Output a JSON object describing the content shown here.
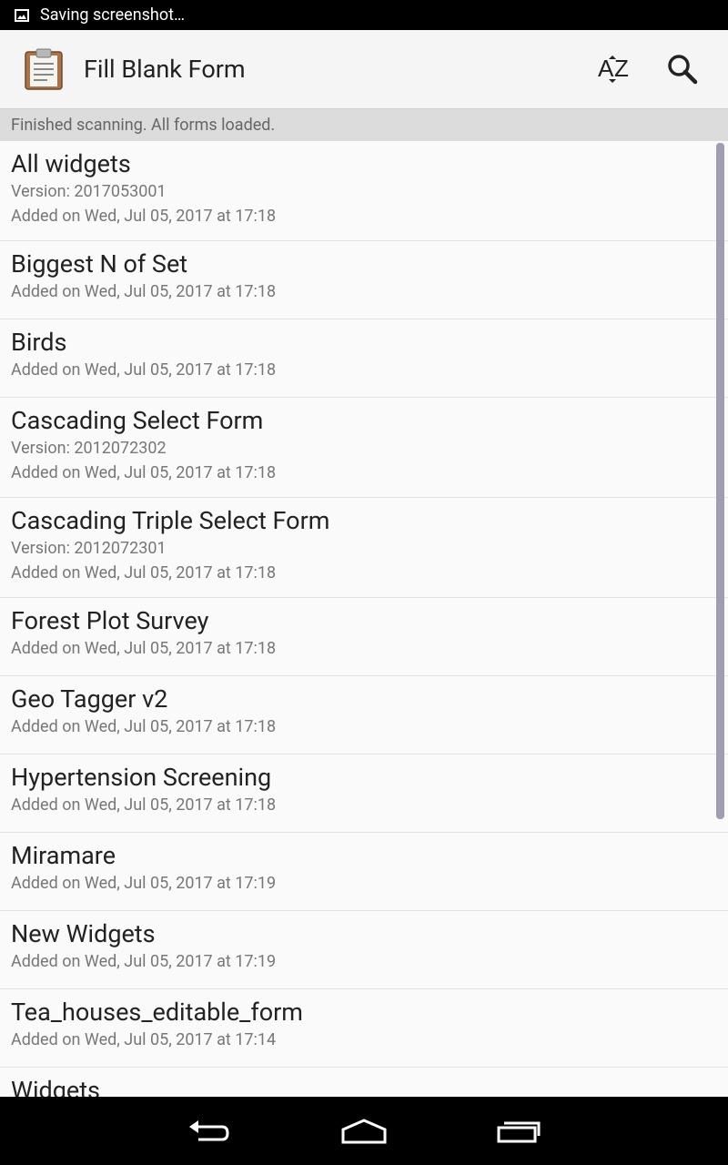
{
  "status_bar": {
    "text": "Saving screenshot…",
    "icon": "image-icon"
  },
  "action_bar": {
    "title": "Fill Blank Form",
    "app_icon": "clipboard-icon",
    "actions": [
      {
        "name": "sort",
        "icon": "sort-az-icon"
      },
      {
        "name": "search",
        "icon": "search-icon"
      }
    ]
  },
  "status_message": "Finished scanning. All forms loaded.",
  "forms": [
    {
      "name": "All widgets",
      "version": "Version: 2017053001",
      "added": "Added on Wed, Jul 05, 2017 at 17:18"
    },
    {
      "name": "Biggest N of Set",
      "added": "Added on Wed, Jul 05, 2017 at 17:18"
    },
    {
      "name": "Birds",
      "added": "Added on Wed, Jul 05, 2017 at 17:18"
    },
    {
      "name": "Cascading Select Form",
      "version": "Version: 2012072302",
      "added": "Added on Wed, Jul 05, 2017 at 17:18"
    },
    {
      "name": "Cascading Triple Select Form",
      "version": "Version: 2012072301",
      "added": "Added on Wed, Jul 05, 2017 at 17:18"
    },
    {
      "name": "Forest Plot Survey",
      "added": "Added on Wed, Jul 05, 2017 at 17:18"
    },
    {
      "name": "Geo Tagger v2",
      "added": "Added on Wed, Jul 05, 2017 at 17:18"
    },
    {
      "name": "Hypertension Screening",
      "added": "Added on Wed, Jul 05, 2017 at 17:18"
    },
    {
      "name": "Miramare",
      "added": "Added on Wed, Jul 05, 2017 at 17:19"
    },
    {
      "name": "New Widgets",
      "added": "Added on Wed, Jul 05, 2017 at 17:19"
    },
    {
      "name": "Tea_houses_editable_form",
      "added": "Added on Wed, Jul 05, 2017 at 17:14"
    },
    {
      "name": "Widgets",
      "added": ""
    }
  ],
  "nav_bar": {
    "buttons": [
      "back-icon",
      "home-icon",
      "recents-icon"
    ]
  },
  "colors": {
    "status_bar": "#000000",
    "action_bar": "#f5f5f5",
    "status_strip": "#dcdcdc",
    "scrollbar": "#9e9eb0"
  }
}
